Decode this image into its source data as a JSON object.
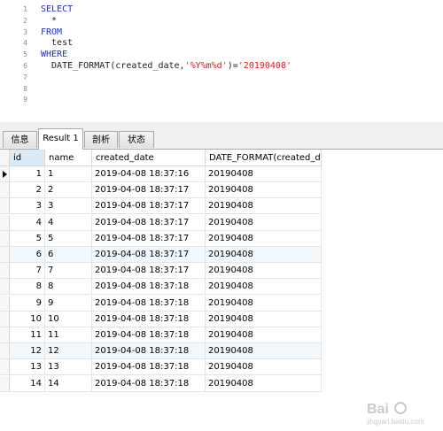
{
  "editor": {
    "lines": [
      {
        "num": "1",
        "parts": [
          {
            "t": "SELECT",
            "c": "kw"
          }
        ]
      },
      {
        "num": "2",
        "parts": [
          {
            "t": "  *",
            "c": "plain"
          }
        ]
      },
      {
        "num": "3",
        "parts": [
          {
            "t": "FROM",
            "c": "kw"
          }
        ]
      },
      {
        "num": "4",
        "parts": [
          {
            "t": "  test",
            "c": "plain"
          }
        ]
      },
      {
        "num": "5",
        "parts": [
          {
            "t": "WHERE",
            "c": "kw"
          }
        ]
      },
      {
        "num": "6",
        "parts": [
          {
            "t": "  DATE_FORMAT(created_date,",
            "c": "plain"
          },
          {
            "t": "'%Y%m%d'",
            "c": "str"
          },
          {
            "t": ")=",
            "c": "punc"
          },
          {
            "t": "'20190408'",
            "c": "str"
          }
        ]
      },
      {
        "num": "7",
        "parts": []
      },
      {
        "num": "8",
        "parts": []
      },
      {
        "num": "9",
        "parts": []
      }
    ]
  },
  "tabs": [
    {
      "label": "信息",
      "active": false
    },
    {
      "label": "Result 1",
      "active": true
    },
    {
      "label": "剖析",
      "active": false
    },
    {
      "label": "状态",
      "active": false
    }
  ],
  "grid": {
    "headers": [
      "id",
      "name",
      "created_date",
      "DATE_FORMAT(created_d"
    ],
    "rows": [
      [
        "1",
        "1",
        "2019-04-08 18:37:16",
        "20190408"
      ],
      [
        "2",
        "2",
        "2019-04-08 18:37:17",
        "20190408"
      ],
      [
        "3",
        "3",
        "2019-04-08 18:37:17",
        "20190408"
      ],
      [
        "4",
        "4",
        "2019-04-08 18:37:17",
        "20190408"
      ],
      [
        "5",
        "5",
        "2019-04-08 18:37:17",
        "20190408"
      ],
      [
        "6",
        "6",
        "2019-04-08 18:37:17",
        "20190408"
      ],
      [
        "7",
        "7",
        "2019-04-08 18:37:17",
        "20190408"
      ],
      [
        "8",
        "8",
        "2019-04-08 18:37:18",
        "20190408"
      ],
      [
        "9",
        "9",
        "2019-04-08 18:37:18",
        "20190408"
      ],
      [
        "10",
        "10",
        "2019-04-08 18:37:18",
        "20190408"
      ],
      [
        "11",
        "11",
        "2019-04-08 18:37:18",
        "20190408"
      ],
      [
        "12",
        "12",
        "2019-04-08 18:37:18",
        "20190408"
      ],
      [
        "13",
        "13",
        "2019-04-08 18:37:18",
        "20190408"
      ],
      [
        "14",
        "14",
        "2019-04-08 18:37:18",
        "20190408"
      ]
    ],
    "current_row": 0
  },
  "watermark": {
    "text": "Bai",
    "subtext": "jingyan.baidu.com"
  },
  "colors": {
    "keyword": "#1f2bd6",
    "string": "#e0181b",
    "sorted_header": "#dbeaf7",
    "alt_row": "#f3f8fc"
  }
}
